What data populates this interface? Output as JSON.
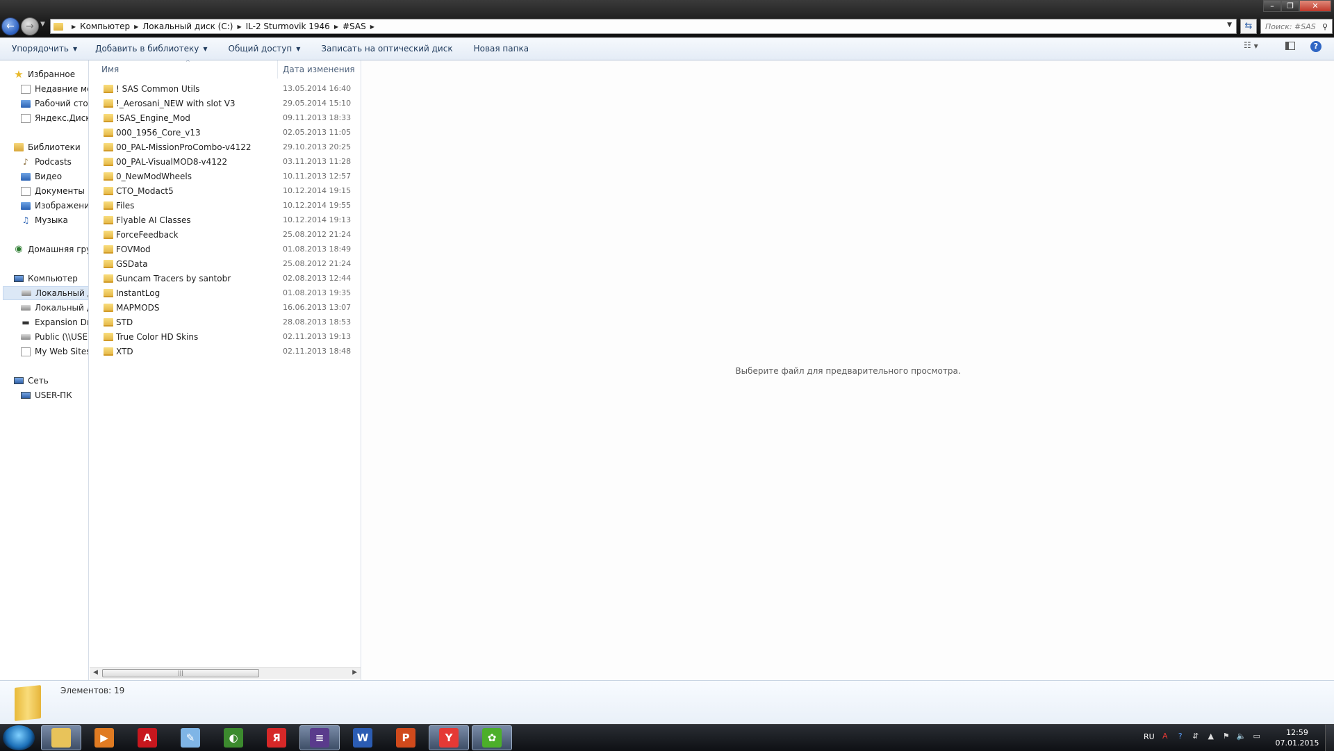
{
  "window": {
    "breadcrumb": [
      "Компьютер",
      "Локальный диск (C:)",
      "IL-2 Sturmovik 1946",
      "#SAS"
    ],
    "search_placeholder": "Поиск: #SAS"
  },
  "toolbar": {
    "organize": "Упорядочить",
    "add_to_library": "Добавить в библиотеку",
    "share": "Общий доступ",
    "burn": "Записать на оптический диск",
    "new_folder": "Новая папка"
  },
  "navpane": {
    "favorites": "Избранное",
    "recent": "Недавние места",
    "desktop": "Рабочий стол",
    "yandex_disk": "Яндекс.Диск",
    "libraries": "Библиотеки",
    "podcasts": "Podcasts",
    "video": "Видео",
    "documents": "Документы",
    "images": "Изображения",
    "music": "Музыка",
    "homegroup": "Домашняя группа",
    "computer": "Компьютер",
    "local_disk_c": "Локальный диск (C:)",
    "local_disk_d": "Локальный диск (D:)",
    "expansion_drive": "Expansion Drive",
    "public_share": "Public (\\\\USER-ПК)",
    "my_web_sites": "My Web Sites on MSN",
    "network": "Сеть",
    "user_pc": "USER-ПК"
  },
  "filelist": {
    "columns": {
      "name": "Имя",
      "date": "Дата изменения"
    },
    "rows": [
      {
        "name": "! SAS Common Utils",
        "date": "13.05.2014 16:40"
      },
      {
        "name": "!_Aerosani_NEW with slot V3",
        "date": "29.05.2014 15:10"
      },
      {
        "name": "!SAS_Engine_Mod",
        "date": "09.11.2013 18:33"
      },
      {
        "name": "000_1956_Core_v13",
        "date": "02.05.2013 11:05"
      },
      {
        "name": "00_PAL-MissionProCombo-v4122",
        "date": "29.10.2013 20:25"
      },
      {
        "name": "00_PAL-VisualMOD8-v4122",
        "date": "03.11.2013 11:28"
      },
      {
        "name": "0_NewModWheels",
        "date": "10.11.2013 12:57"
      },
      {
        "name": "CTO_Modact5",
        "date": "10.12.2014 19:15"
      },
      {
        "name": "Files",
        "date": "10.12.2014 19:55"
      },
      {
        "name": "Flyable AI Classes",
        "date": "10.12.2014 19:13"
      },
      {
        "name": "ForceFeedback",
        "date": "25.08.2012 21:24"
      },
      {
        "name": "FOVMod",
        "date": "01.08.2013 18:49"
      },
      {
        "name": "GSData",
        "date": "25.08.2012 21:24"
      },
      {
        "name": "Guncam Tracers by santobr",
        "date": "02.08.2013 12:44"
      },
      {
        "name": "InstantLog",
        "date": "01.08.2013 19:35"
      },
      {
        "name": "MAPMODS",
        "date": "16.06.2013 13:07"
      },
      {
        "name": "STD",
        "date": "28.08.2013 18:53"
      },
      {
        "name": "True Color HD Skins",
        "date": "02.11.2013 19:13"
      },
      {
        "name": "XTD",
        "date": "02.11.2013 18:48"
      }
    ]
  },
  "preview": {
    "message": "Выберите файл для предварительного просмотра."
  },
  "details": {
    "count": "Элементов: 19"
  },
  "taskbar": {
    "apps": [
      {
        "name": "explorer",
        "glyph": "",
        "color": "#e8c35a",
        "active": true
      },
      {
        "name": "media-player",
        "glyph": "▶",
        "color": "#e07b22",
        "active": false
      },
      {
        "name": "acrobat",
        "glyph": "A",
        "color": "#c8171e",
        "active": false
      },
      {
        "name": "notepad",
        "glyph": "✎",
        "color": "#7fb5e6",
        "active": false
      },
      {
        "name": "corel",
        "glyph": "◐",
        "color": "#3c8a2e",
        "active": false
      },
      {
        "name": "yandex",
        "glyph": "Я",
        "color": "#d62828",
        "active": false
      },
      {
        "name": "winrar",
        "glyph": "≡",
        "color": "#5a3b8c",
        "active": true
      },
      {
        "name": "word",
        "glyph": "W",
        "color": "#2b5cb3",
        "active": false
      },
      {
        "name": "powerpoint",
        "glyph": "P",
        "color": "#d04a1c",
        "active": false
      },
      {
        "name": "yandex-browser",
        "glyph": "Y",
        "color": "#e53935",
        "active": true
      },
      {
        "name": "icq",
        "glyph": "✿",
        "color": "#4caf2a",
        "active": true
      }
    ],
    "language": "RU",
    "time": "12:59",
    "date": "07.01.2015"
  }
}
